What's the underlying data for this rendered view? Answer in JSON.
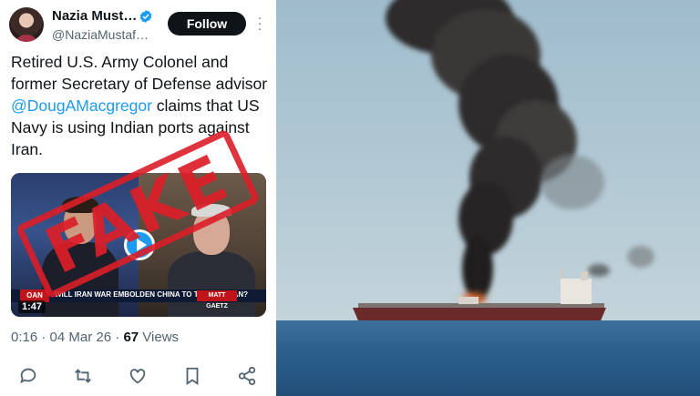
{
  "tweet": {
    "display_name": "Nazia Must…",
    "handle": "@NaziaMustaf…",
    "follow_label": "Follow",
    "text_before": "Retired U.S. Army Colonel and former Secretary of Defense advisor ",
    "mention": "@DougAMacgregor",
    "text_after": " claims that US Navy is using Indian ports against Iran.",
    "video": {
      "duration": "1:47",
      "chyron": "WILL IRAN WAR EMBOLDEN CHINA TO TAKE TAIWAN?",
      "chyron_logo": "MATT GAETZ",
      "network_logo": "OAN"
    },
    "stamp_text": "FAKE",
    "meta": {
      "time": "0:16",
      "date": "04 Mar 26",
      "views": "67",
      "views_label": "Views"
    },
    "colors": {
      "accent": "#1d9bf0",
      "stamp": "#dc1e28",
      "text": "#0f1419",
      "muted": "#536471"
    },
    "icons": [
      "verified-icon",
      "more-icon",
      "reply-icon",
      "retweet-icon",
      "like-icon",
      "bookmark-icon",
      "share-icon",
      "play-icon"
    ]
  },
  "photo": {
    "subject": "oil-tanker-smoke"
  }
}
